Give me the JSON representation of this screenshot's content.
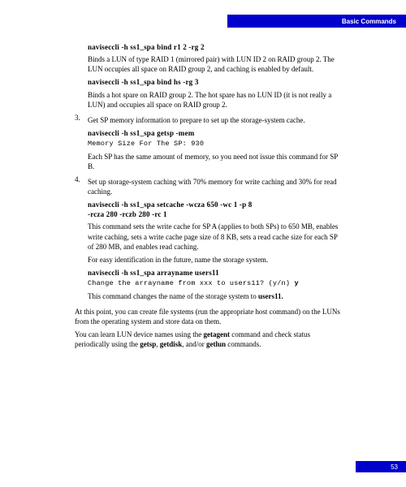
{
  "header": {
    "title": "Basic Commands"
  },
  "footer": {
    "page": "53"
  },
  "block1": {
    "cmd": "naviseccli   -h   ss1_spa   bind   r1   2   -rg   2",
    "para": "Binds a LUN of type RAID 1 (mirrored pair) with LUN ID 2 on RAID group 2. The LUN occupies all space on RAID group 2, and caching is enabled by default."
  },
  "block2": {
    "cmd": "naviseccli   -h   ss1_spa   bind   hs   -rg   3",
    "para": "Binds a hot spare on RAID group 2. The hot spare has no LUN ID (it is not really a LUN) and occupies all space on RAID group 2."
  },
  "step3": {
    "num": "3.",
    "text": "Get SP memory information to prepare to set up the storage-system cache.",
    "cmd": "naviseccli   -h   ss1_spa   getsp   -mem",
    "mono": "Memory Size For The SP:      930",
    "para": "Each SP has the same amount of memory, so you need not issue this command for SP B."
  },
  "step4": {
    "num": "4.",
    "text": "Set up storage-system caching with 70% memory for write caching and 30% for read caching.",
    "cmd1": "naviseccli   -h   ss1_spa   setcache   -wcza  650  -wc   1  -p  8",
    "cmd2": "-rcza  280  -rczb  280  -rc 1",
    "para1": "This command sets the write cache for SP A (applies to both SPs) to 650 MB, enables write caching, sets a write cache page size of 8 KB, sets a read cache size for each SP of 280 MB, and enables read caching.",
    "para2": "For easy identification in the future, name the storage system.",
    "cmd3": "naviseccli   -h   ss1_spa   arrayname   users11",
    "mono_prefix": "Change the arrayname from xxx to users11? (y/n) ",
    "mono_bold": "y",
    "para3_a": "This command changes the name of the storage system to ",
    "para3_b": "users11."
  },
  "tail": {
    "p1": "At this point, you can create file systems (run the appropriate host command) on the LUNs from the operating system and store data on them.",
    "p2a": "You can learn LUN device names using the ",
    "p2b": "getagent",
    "p2c": " command and check status periodically using the ",
    "p2d": "getsp",
    "p2e": ", ",
    "p2f": "getdisk",
    "p2g": ", and/or ",
    "p2h": "getlun",
    "p2i": " commands."
  }
}
